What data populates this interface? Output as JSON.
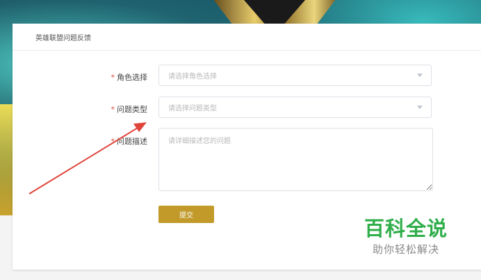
{
  "form": {
    "title": "英雄联盟问题反馈",
    "required_mark": "*",
    "role": {
      "label": "角色选择",
      "placeholder": "请选择角色选择"
    },
    "issue_type": {
      "label": "问题类型",
      "placeholder": "请选择问题类型"
    },
    "description": {
      "label": "问题描述",
      "placeholder": "请详细描述您的问题"
    },
    "submit_label": "提交"
  },
  "watermark": {
    "title": "百科全说",
    "subtitle": "助你轻松解决"
  },
  "colors": {
    "accent": "#c19a2a",
    "required": "#e0463a",
    "annotation_arrow": "#e0443a",
    "watermark": "#2fae4a"
  },
  "icons": [
    "chevron-down-icon",
    "annotation-arrow"
  ]
}
